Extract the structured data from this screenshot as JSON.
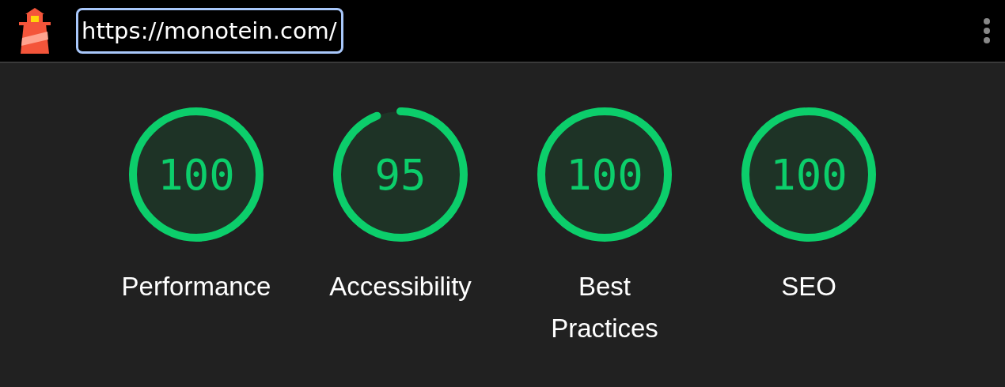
{
  "url_bar": {
    "value": "https://monotein.com/"
  },
  "gauges": [
    {
      "score": "100",
      "label": "Performance"
    },
    {
      "score": "95",
      "label": "Accessibility"
    },
    {
      "score": "100",
      "label": "Best Practices"
    },
    {
      "score": "100",
      "label": "SEO"
    }
  ]
}
